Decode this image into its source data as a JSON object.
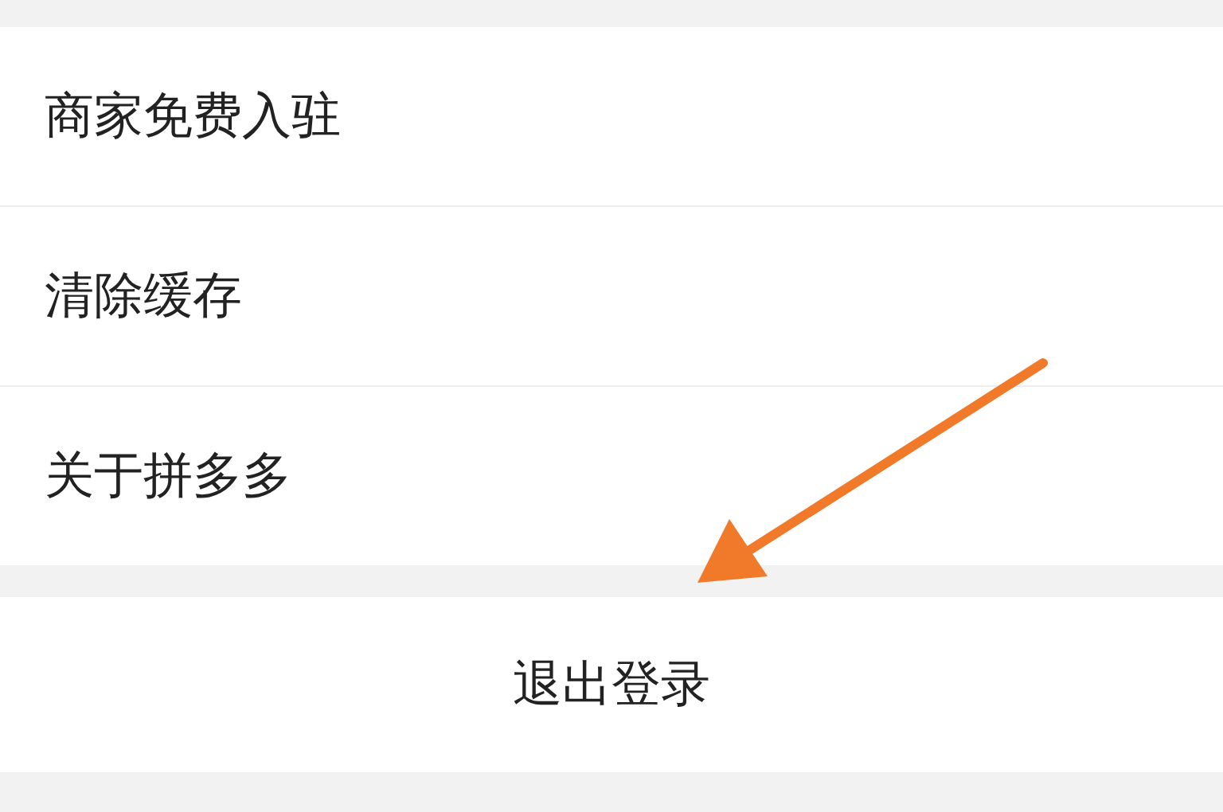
{
  "menu_items": [
    {
      "label": "商家免费入驻"
    },
    {
      "label": "清除缓存"
    },
    {
      "label": "关于拼多多"
    }
  ],
  "logout_button": {
    "label": "退出登录"
  }
}
